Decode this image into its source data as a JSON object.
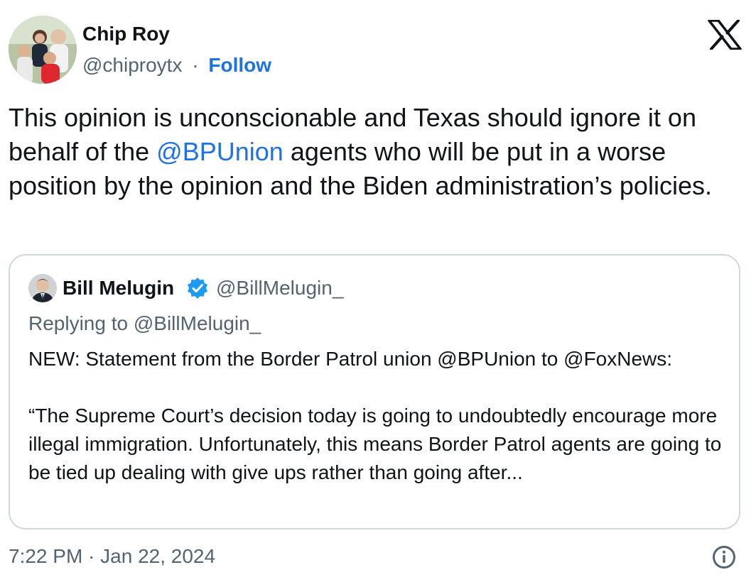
{
  "author": {
    "name": "Chip Roy",
    "handle": "@chiproytx",
    "separator": "·",
    "follow_label": "Follow"
  },
  "brand_icon": "x-logo-icon",
  "tweet": {
    "text_before": "This opinion is unconscionable and Texas should ignore it on behalf of the ",
    "mention": "@BPUnion",
    "text_after": " agents who will be put in a worse position by the opinion and the Biden administration’s policies."
  },
  "quoted_tweet": {
    "name": "Bill Melugin",
    "verified_icon": "verified-badge-icon",
    "handle": "@BillMelugin_",
    "replying_to": "Replying to @BillMelugin_",
    "text": "NEW: Statement from the Border Patrol union @BPUnion to @FoxNews:\n\n“The Supreme Court’s decision today is going to undoubtedly encourage more illegal immigration. Unfortunately, this means Border Patrol agents are going to be tied up dealing with give ups rather than going after..."
  },
  "footer": {
    "timestamp": "7:22 PM · Jan 22, 2024",
    "info_icon": "info-icon"
  },
  "colors": {
    "text": "#0f1419",
    "secondary": "#536471",
    "link": "#1d72e8",
    "border": "#cfd9de",
    "verified": "#1d9bf0"
  }
}
